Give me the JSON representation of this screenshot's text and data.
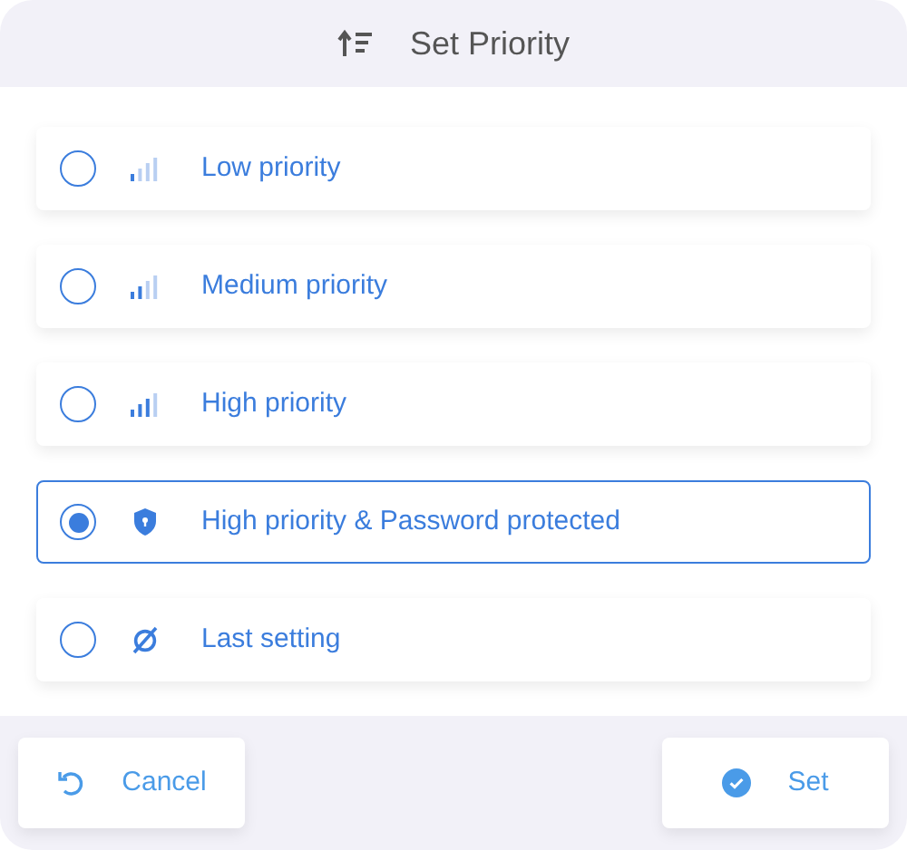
{
  "header": {
    "title": "Set Priority"
  },
  "options": [
    {
      "kind": "low",
      "label": "Low priority",
      "selected": false
    },
    {
      "kind": "medium",
      "label": "Medium priority",
      "selected": false
    },
    {
      "kind": "high",
      "label": "High priority",
      "selected": false
    },
    {
      "kind": "shield",
      "label": "High priority & Password protected",
      "selected": true
    },
    {
      "kind": "none",
      "label": "Last setting",
      "selected": false
    }
  ],
  "buttons": [
    {
      "kind": "cancel",
      "label": "Cancel"
    },
    {
      "kind": "set",
      "label": "Set"
    }
  ]
}
